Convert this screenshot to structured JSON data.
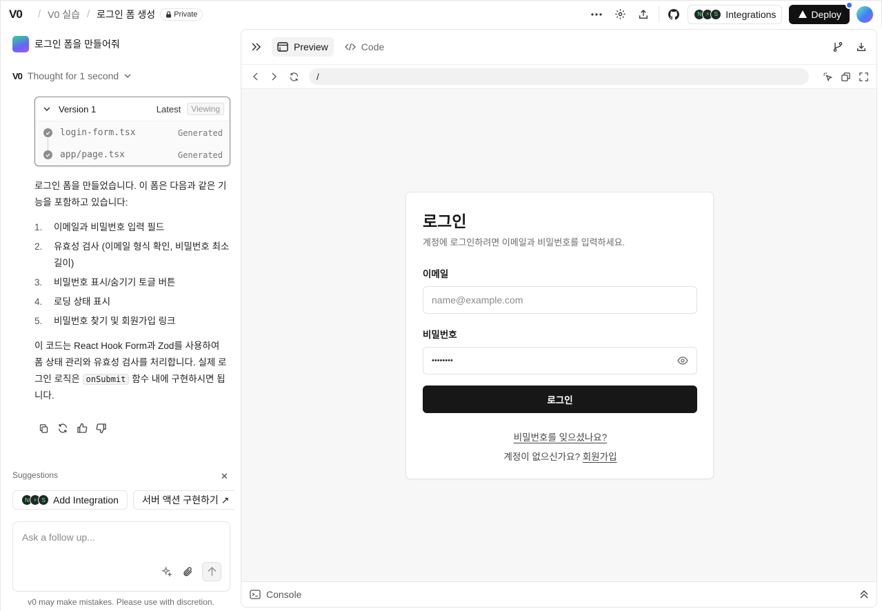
{
  "topbar": {
    "logo": "V0",
    "crumbs": [
      "V0 실습",
      "로그인 폼 생성"
    ],
    "visibility": "Private",
    "integrations_label": "Integrations",
    "deploy_label": "Deploy"
  },
  "chat": {
    "user_message": "로그인 폼을 만들어줘",
    "thought_label": "Thought for 1 second",
    "version": {
      "title": "Version 1",
      "latest": "Latest",
      "viewing": "Viewing",
      "files": [
        {
          "name": "login-form.tsx",
          "status": "Generated"
        },
        {
          "name": "app/page.tsx",
          "status": "Generated"
        }
      ]
    },
    "answer_intro": "로그인 폼을 만들었습니다. 이 폼은 다음과 같은 기능을 포함하고 있습니다:",
    "answer_list": [
      {
        "num": "1.",
        "text": "이메일과 비밀번호 입력 필드"
      },
      {
        "num": "2.",
        "text": "유효성 검사 (이메일 형식 확인, 비밀번호 최소 길이)"
      },
      {
        "num": "3.",
        "text": "비밀번호 표시/숨기기 토글 버튼"
      },
      {
        "num": "4.",
        "text": "로딩 상태 표시"
      },
      {
        "num": "5.",
        "text": "비밀번호 찾기 및 회원가입 링크"
      }
    ],
    "answer_outro_1": "이 코드는 React Hook Form과 Zod를 사용하여 폼 상태 관리와 유효성 검사를 처리합니다. 실제 로그인 로직은",
    "answer_code": "onSubmit",
    "answer_outro_2": "함수 내에 구현하시면 됩니다.",
    "suggestions_title": "Suggestions",
    "suggestions": [
      "Add Integration",
      "서버 액션 구현하기 ↗"
    ],
    "composer_placeholder": "Ask a follow up...",
    "disclaimer": "v0 may make mistakes. Please use with discretion."
  },
  "preview": {
    "tabs": [
      "Preview",
      "Code"
    ],
    "url": "/",
    "console_label": "Console",
    "login_card": {
      "title": "로그인",
      "description": "계정에 로그인하려면 이메일과 비밀번호를 입력하세요.",
      "email_label": "이메일",
      "email_placeholder": "name@example.com",
      "password_label": "비밀번호",
      "password_value": "••••••••",
      "submit_label": "로그인",
      "forgot_link": "비밀번호를 잊으셨나요?",
      "signup_prompt": "계정이 없으신가요?",
      "signup_link": "회원가입"
    }
  }
}
